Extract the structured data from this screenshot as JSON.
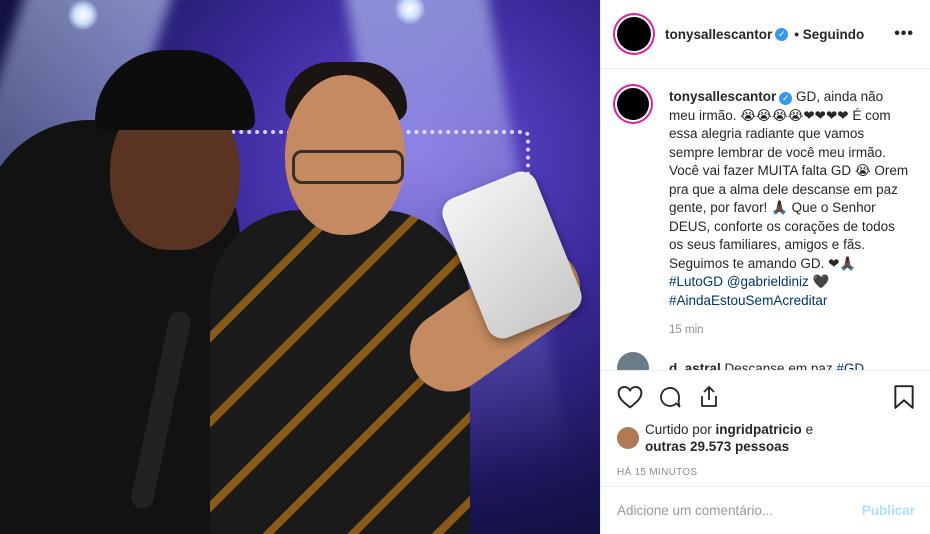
{
  "post": {
    "username": "tonysallescantor",
    "follow_status": "Seguindo",
    "more": "•••"
  },
  "caption": {
    "username": "tonysallescantor",
    "body_1": " GD, ainda não meu irmão. 😭😭😭😭❤❤❤❤ É com essa alegria radiante que vamos sempre lembrar de você meu irmão. Você vai fazer MUITA falta GD 😭 Orem pra que a alma dele descanse em paz gente, por favor! 🙏🏿 Que o Senhor DEUS, conforte os corações de todos os seus familiares, amigos e fãs. Seguimos te amando GD. ❤🙏🏿",
    "tag1": "#LutoGD",
    "mention": "@gabrieldiniz",
    "heart": " 🖤",
    "tag2": "#AindaEstouSemAcreditar",
    "time": "15 min"
  },
  "comment2": {
    "username": "d_astral",
    "text": " Descanse em paz ",
    "tag": "#GD"
  },
  "likes": {
    "prefix": "Curtido por ",
    "user": "ingridpatricio",
    "mid": " e",
    "others": "outras 29.573 pessoas"
  },
  "posted_ago": "HÁ 15 MINUTOS",
  "comment_box": {
    "placeholder": "Adicione um comentário...",
    "publish": "Publicar"
  },
  "icons": [
    "heart-icon",
    "comment-icon",
    "share-icon",
    "bookmark-icon"
  ],
  "colors": {
    "verified": "#3897f0",
    "tag": "#003569",
    "publish_disabled": "#b2dffc",
    "story_ring": "#d6249f"
  }
}
